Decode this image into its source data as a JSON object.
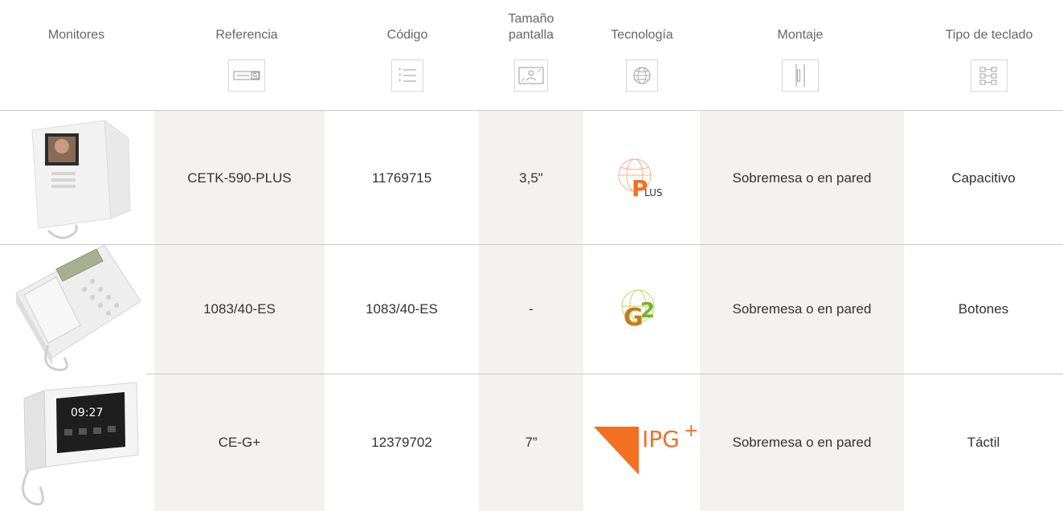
{
  "headers": [
    {
      "label": "Monitores",
      "icon": null
    },
    {
      "label": "Referencia",
      "icon": "reference-search-icon"
    },
    {
      "label": "Código",
      "icon": "list-icon"
    },
    {
      "label": "Tamaño pantalla",
      "icon": "screen-size-icon"
    },
    {
      "label": "Tecnología",
      "icon": "technology-globe-icon"
    },
    {
      "label": "Montaje",
      "icon": "mounting-icon"
    },
    {
      "label": "Tipo de teclado",
      "icon": "keyboard-type-icon"
    }
  ],
  "rows": [
    {
      "product_image": "handset-monitor-small-screen",
      "referencia": "CETK-590-PLUS",
      "codigo": "11769715",
      "tamano": "3,5\"",
      "tecnologia_logo": "plus-logo",
      "tecnologia_text": "LUS",
      "montaje": "Sobremesa o en pared",
      "teclado": "Capacitivo"
    },
    {
      "product_image": "desk-phone-lcd",
      "referencia": "1083/40-ES",
      "codigo": "1083/40-ES",
      "tamano": "-",
      "tecnologia_logo": "g2-logo",
      "tecnologia_text": "G2",
      "montaje": "Sobremesa o en pared",
      "teclado": "Botones"
    },
    {
      "product_image": "touch-monitor-7in",
      "referencia": "CE-G+",
      "codigo": "12379702",
      "tamano": "7”",
      "tecnologia_logo": "ipg-plus-logo",
      "tecnologia_text": "IPG",
      "montaje": "Sobremesa o en pared",
      "teclado": "Táctil"
    }
  ],
  "colors": {
    "accent_orange": "#f36f21",
    "band": "#f3f2ee",
    "divider": "#c9c9c9"
  }
}
